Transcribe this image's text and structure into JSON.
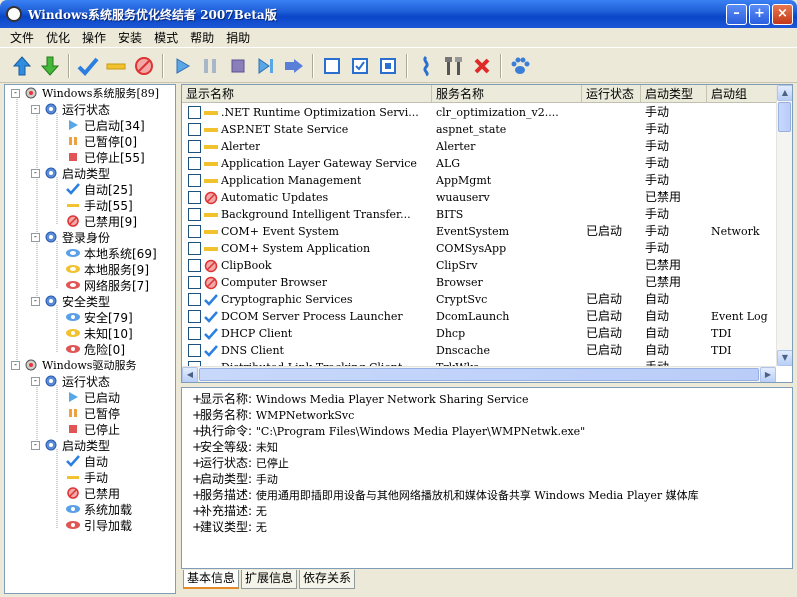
{
  "window": {
    "title": "Windows系统服务优化终结者 2007Beta版"
  },
  "menu": [
    "文件",
    "优化",
    "操作",
    "安装",
    "模式",
    "帮助",
    "捐助"
  ],
  "toolbar": {
    "icons": [
      "arrow-up-icon",
      "arrow-down-icon",
      "check-icon",
      "minus-icon",
      "disabled-icon",
      "play-icon",
      "pause-icon",
      "stop-icon",
      "next-icon",
      "fast-forward-icon",
      "square-icon",
      "checked-square-icon",
      "filled-square-icon",
      "link-icon",
      "tools-icon",
      "delete-icon",
      "paw-icon"
    ]
  },
  "tree": {
    "root1": "Windows系统服务[89]",
    "run_state": "运行状态",
    "started": "已启动[34]",
    "paused": "已暂停[0]",
    "stopped": "已停止[55]",
    "start_type": "启动类型",
    "auto": "自动[25]",
    "manual": "手动[55]",
    "disabled": "已禁用[9]",
    "login_id": "登录身份",
    "local_system": "本地系统[69]",
    "local_service": "本地服务[9]",
    "network_service": "网络服务[7]",
    "security_type": "安全类型",
    "safe": "安全[79]",
    "unknown": "未知[10]",
    "danger": "危险[0]",
    "root2": "Windows驱动服务",
    "d_run_state": "运行状态",
    "d_started": "已启动",
    "d_paused": "已暂停",
    "d_stopped": "已停止",
    "d_start_type": "启动类型",
    "d_auto": "自动",
    "d_manual": "手动",
    "d_disabled": "已禁用",
    "d_system_load": "系统加载",
    "d_boot_load": "引导加载"
  },
  "columns": [
    "显示名称",
    "服务名称",
    "运行状态",
    "启动类型",
    "启动组"
  ],
  "rows": [
    {
      "icon": "minus-icon",
      "name": ".NET Runtime Optimization Servi...",
      "service": "clr_optimization_v2....",
      "state": "",
      "start": "手动",
      "group": ""
    },
    {
      "icon": "minus-icon",
      "name": "ASP.NET State Service",
      "service": "aspnet_state",
      "state": "",
      "start": "手动",
      "group": ""
    },
    {
      "icon": "minus-icon",
      "name": "Alerter",
      "service": "Alerter",
      "state": "",
      "start": "手动",
      "group": ""
    },
    {
      "icon": "minus-icon",
      "name": "Application Layer Gateway Service",
      "service": "ALG",
      "state": "",
      "start": "手动",
      "group": ""
    },
    {
      "icon": "minus-icon",
      "name": "Application Management",
      "service": "AppMgmt",
      "state": "",
      "start": "手动",
      "group": ""
    },
    {
      "icon": "disabled-icon",
      "name": "Automatic Updates",
      "service": "wuauserv",
      "state": "",
      "start": "已禁用",
      "group": ""
    },
    {
      "icon": "minus-icon",
      "name": "Background Intelligent Transfer...",
      "service": "BITS",
      "state": "",
      "start": "手动",
      "group": ""
    },
    {
      "icon": "minus-icon",
      "name": "COM+ Event System",
      "service": "EventSystem",
      "state": "已启动",
      "start": "手动",
      "group": "Network"
    },
    {
      "icon": "minus-icon",
      "name": "COM+ System Application",
      "service": "COMSysApp",
      "state": "",
      "start": "手动",
      "group": ""
    },
    {
      "icon": "disabled-icon",
      "name": "ClipBook",
      "service": "ClipSrv",
      "state": "",
      "start": "已禁用",
      "group": ""
    },
    {
      "icon": "disabled-icon",
      "name": "Computer Browser",
      "service": "Browser",
      "state": "",
      "start": "已禁用",
      "group": ""
    },
    {
      "icon": "check-icon",
      "name": "Cryptographic Services",
      "service": "CryptSvc",
      "state": "已启动",
      "start": "自动",
      "group": ""
    },
    {
      "icon": "check-icon",
      "name": "DCOM Server Process Launcher",
      "service": "DcomLaunch",
      "state": "已启动",
      "start": "自动",
      "group": "Event Log"
    },
    {
      "icon": "check-icon",
      "name": "DHCP Client",
      "service": "Dhcp",
      "state": "已启动",
      "start": "自动",
      "group": "TDI"
    },
    {
      "icon": "check-icon",
      "name": "DNS Client",
      "service": "Dnscache",
      "state": "已启动",
      "start": "自动",
      "group": "TDI"
    },
    {
      "icon": "minus-icon",
      "name": "Distributed Link Tracking Client",
      "service": "TrkWks",
      "state": "",
      "start": "手动",
      "group": ""
    }
  ],
  "details": [
    {
      "label": "显示名称:",
      "value": "Windows Media Player Network Sharing Service"
    },
    {
      "label": "服务名称:",
      "value": "WMPNetworkSvc"
    },
    {
      "label": "执行命令:",
      "value": "\"C:\\Program Files\\Windows Media Player\\WMPNetwk.exe\""
    },
    {
      "label": "安全等级:",
      "value": "未知"
    },
    {
      "label": "运行状态:",
      "value": "已停止"
    },
    {
      "label": "启动类型:",
      "value": "手动"
    },
    {
      "label": "服务描述:",
      "value": "使用通用即插即用设备与其他网络播放机和媒体设备共享 Windows Media Player 媒体库"
    },
    {
      "label": "补充描述:",
      "value": "无"
    },
    {
      "label": "建议类型:",
      "value": "无"
    }
  ],
  "tabs": [
    "基本信息",
    "扩展信息",
    "依存关系"
  ]
}
